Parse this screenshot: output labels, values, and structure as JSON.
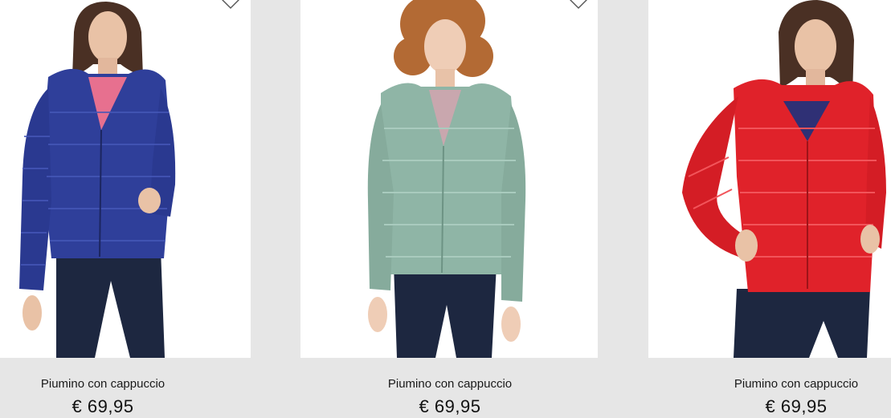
{
  "products": [
    {
      "name": "Piumino con cappuccio",
      "price": "€ 69,95",
      "color_name": "blue",
      "jacket_color": "#2f3f9a",
      "wishlist_icon": "heart-outline-icon"
    },
    {
      "name": "Piumino con cappuccio",
      "price": "€ 69,95",
      "color_name": "sage green",
      "jacket_color": "#8fb5a6",
      "wishlist_icon": "heart-outline-icon"
    },
    {
      "name": "Piumino con cappuccio",
      "price": "€ 69,95",
      "color_name": "red",
      "jacket_color": "#e0222a",
      "wishlist_icon": "heart-outline-icon"
    }
  ],
  "colors": {
    "page_background": "#e6e6e6",
    "photo_background": "#ffffff",
    "denim": "#1d2740"
  }
}
